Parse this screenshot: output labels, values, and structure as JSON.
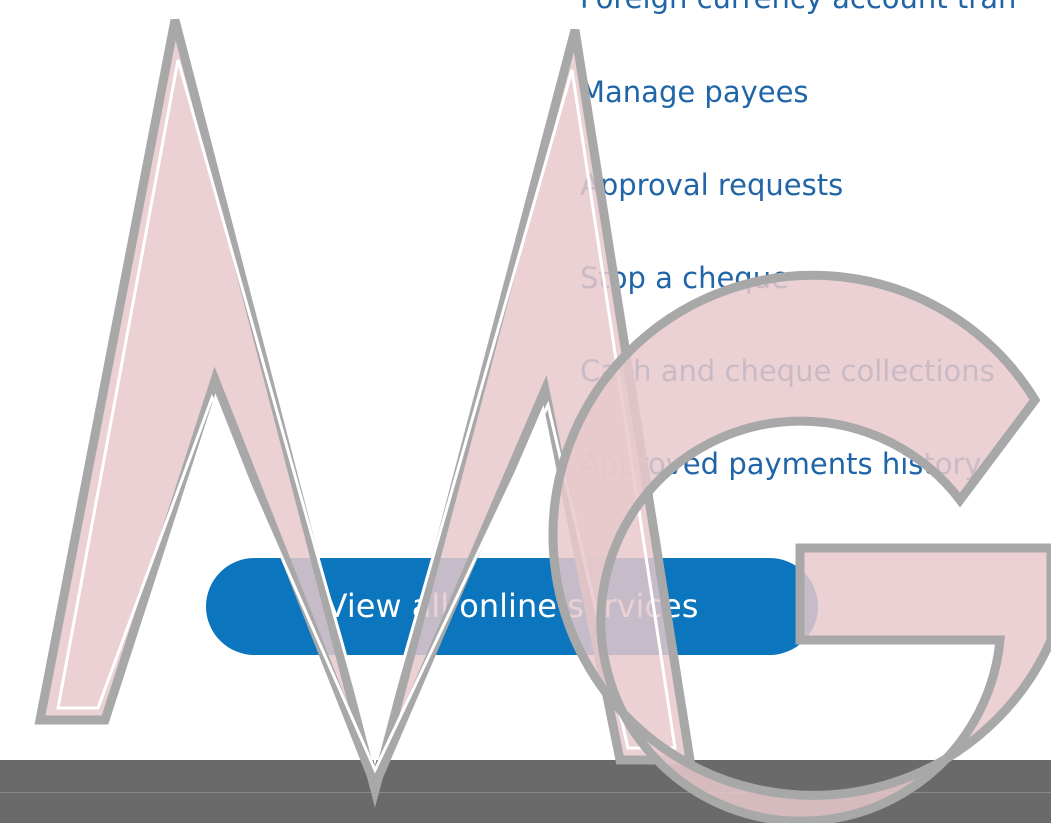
{
  "services_menu": {
    "items": [
      {
        "label": "Foreign currency account tran"
      },
      {
        "label": "Manage payees"
      },
      {
        "label": "Approval requests"
      },
      {
        "label": "Stop a cheque"
      },
      {
        "label": "Cash and cheque collections"
      },
      {
        "label": "Approved payments history"
      }
    ],
    "link_color": "#1f65a8"
  },
  "cta": {
    "label": "View all online services",
    "background": "#0b75bd"
  },
  "footer": {
    "background": "#6a6a6a"
  },
  "watermark": {
    "text": "MG",
    "fill": "#e8c9cb",
    "outline": "#a8a8a8"
  }
}
